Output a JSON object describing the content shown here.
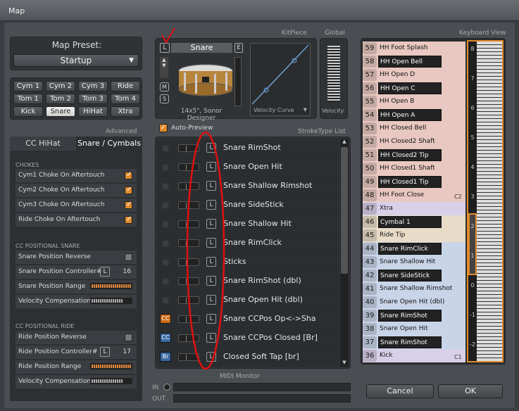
{
  "window": {
    "title": "Map"
  },
  "preset": {
    "label": "Map Preset:",
    "value": "Startup"
  },
  "pieces": [
    "Cym 1",
    "Cym 2",
    "Cym 3",
    "Ride",
    "Tom 1",
    "Tom 2",
    "Tom 3",
    "Tom 4",
    "Kick",
    "Snare",
    "HiHat",
    "Xtra"
  ],
  "selected_piece": "Snare",
  "advanced": {
    "label": "Advanced",
    "tabs": [
      "CC HiHat",
      "Snare / Cymbals"
    ],
    "chokes_title": "CHOKES",
    "chokes": [
      "Cym1 Choke On Aftertouch",
      "Cym2 Choke On Aftertouch",
      "Cym3 Choke On Aftertouch",
      "Ride Choke On Aftertouch"
    ],
    "snare_title": "CC POSITIONAL SNARE",
    "snare_rows": [
      "Snare Position Reverse",
      "Snare Position Controller#",
      "Snare Position Range",
      "Velocity Compensation"
    ],
    "snare_controller": "16",
    "ride_title": "CC POSITIONAL RIDE",
    "ride_rows": [
      "Ride Position Reverse",
      "Ride Position Controller#",
      "Ride Position Range",
      "Velocity Compensation"
    ],
    "ride_controller": "17",
    "l_label": "L"
  },
  "kitpiece": {
    "header": "KitPiece",
    "global": "Global",
    "name": "Snare",
    "l": "L",
    "e": "E",
    "m": "M",
    "s": "S",
    "caption": "14x5\", Sonor Designer",
    "curve_label": "Velocity Curve",
    "velocity_label": "Velocity"
  },
  "autopreview": {
    "label": "Auto-Preview",
    "list_label": "StrokeType List"
  },
  "strokes": [
    {
      "name": "Snare RimShot",
      "icon": ""
    },
    {
      "name": "Snare Open Hit",
      "icon": ""
    },
    {
      "name": "Snare Shallow Rimshot",
      "icon": ""
    },
    {
      "name": "Snare SideStick",
      "icon": ""
    },
    {
      "name": "Snare Shallow Hit",
      "icon": ""
    },
    {
      "name": "Snare RimClick",
      "icon": ""
    },
    {
      "name": "Sticks",
      "icon": ""
    },
    {
      "name": "Snare RimShot (dbl)",
      "icon": ""
    },
    {
      "name": "Snare Open Hit (dbl)",
      "icon": ""
    },
    {
      "name": "Snare CCPos Op<->Sha",
      "icon": "CC"
    },
    {
      "name": "Snare CCPos Closed [Br]",
      "icon": "CC Br"
    },
    {
      "name": "Closed Soft Tap [br]",
      "icon": "Br"
    }
  ],
  "keyboard": {
    "label": "Keyboard View",
    "rows": [
      {
        "num": "59",
        "name": "HH Foot Splash"
      },
      {
        "num": "58",
        "name": "HH Open Bell"
      },
      {
        "num": "57",
        "name": "HH Open D"
      },
      {
        "num": "56",
        "name": "HH Open C"
      },
      {
        "num": "55",
        "name": "HH Open B"
      },
      {
        "num": "54",
        "name": "HH Open A"
      },
      {
        "num": "53",
        "name": "HH Closed Bell"
      },
      {
        "num": "52",
        "name": "HH Closed2 Shaft"
      },
      {
        "num": "51",
        "name": "HH Closed2 Tip"
      },
      {
        "num": "50",
        "name": "HH Closed1 Shaft"
      },
      {
        "num": "49",
        "name": "HH Closed1 Tip"
      },
      {
        "num": "48",
        "name": "HH Foot Close"
      },
      {
        "num": "47",
        "name": "Xtra"
      },
      {
        "num": "46",
        "name": "Cymbal 1"
      },
      {
        "num": "45",
        "name": "Ride Tip"
      },
      {
        "num": "44",
        "name": "Snare RimClick"
      },
      {
        "num": "43",
        "name": "Snare Shallow Hit"
      },
      {
        "num": "42",
        "name": "Snare SideStick"
      },
      {
        "num": "41",
        "name": "Snare Shallow Rimshot"
      },
      {
        "num": "40",
        "name": "Snare Open Hit (dbl)"
      },
      {
        "num": "39",
        "name": "Snare RimShot (dbl)"
      },
      {
        "num": "38",
        "name": "Snare Open Hit"
      },
      {
        "num": "37",
        "name": "Snare RimShot"
      },
      {
        "num": "36",
        "name": "Kick"
      }
    ],
    "c2": "C2",
    "c1": "C1",
    "octaves": [
      "8",
      "7",
      "6",
      "5",
      "4",
      "3",
      "2",
      "1",
      "0",
      "-1",
      "-2"
    ]
  },
  "midi": {
    "label": "MIDI Monitor",
    "in": "IN",
    "out": "OUT"
  },
  "buttons": {
    "cancel": "Cancel",
    "ok": "OK"
  },
  "colors": {
    "hihat": "#e8c8c0",
    "cymbal": "#e8dcc8",
    "snare": "#c8d4e8",
    "kick": "#d8d0e8",
    "accent": "#e08a2a"
  }
}
